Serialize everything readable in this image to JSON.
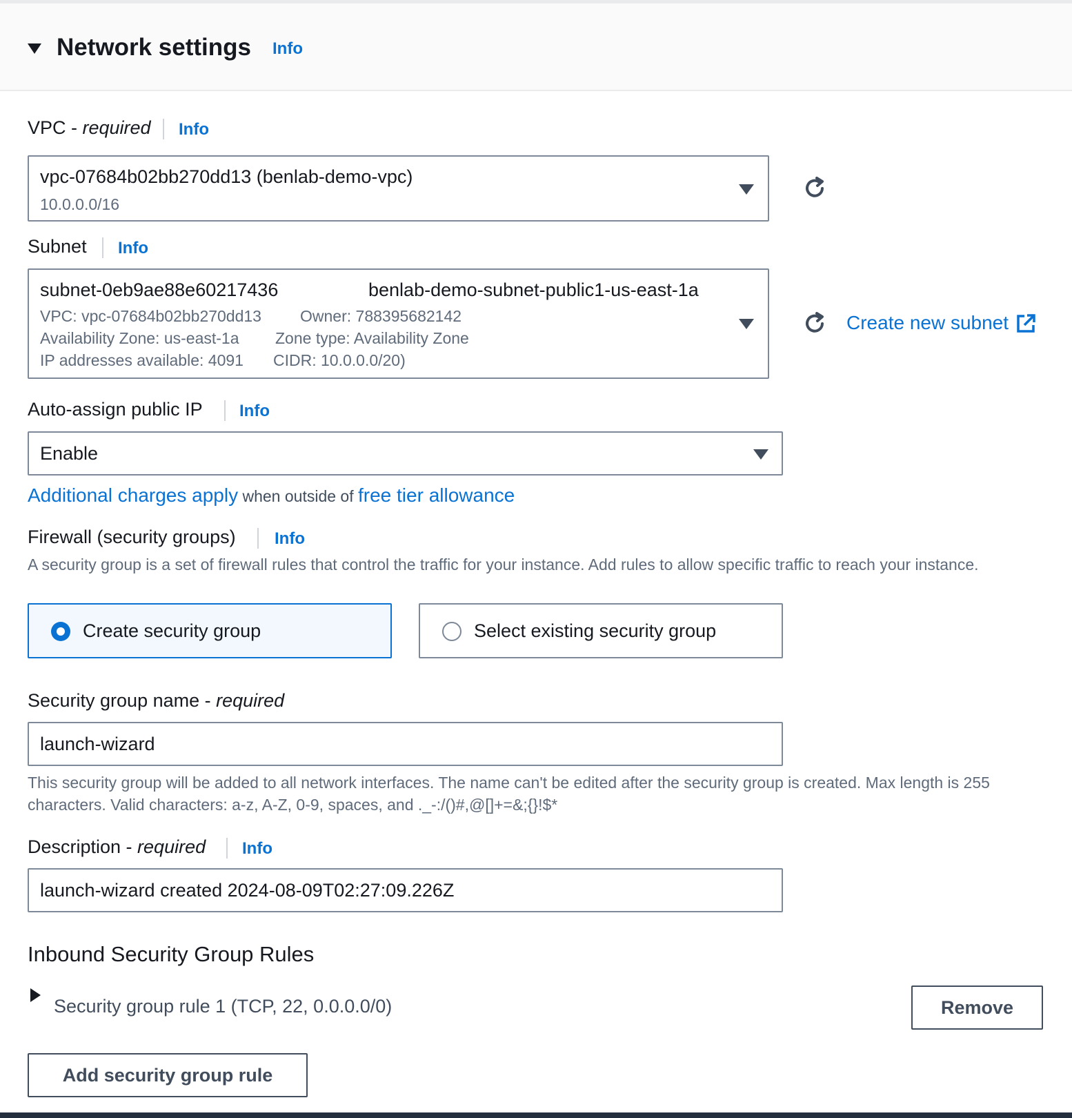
{
  "header": {
    "title": "Network settings",
    "info": "Info"
  },
  "vpc": {
    "label": "VPC - ",
    "label_req": "required",
    "info": "Info",
    "value": "vpc-07684b02bb270dd13 (benlab-demo-vpc)",
    "cidr": "10.0.0.0/16"
  },
  "subnet": {
    "label": "Subnet",
    "info": "Info",
    "id": "subnet-0eb9ae88e60217436",
    "name": "benlab-demo-subnet-public1-us-east-1a",
    "vpc": "VPC: vpc-07684b02bb270dd13",
    "owner": "Owner: 788395682142",
    "az": "Availability Zone: us-east-1a",
    "zone_type": "Zone type: Availability Zone",
    "ips": "IP addresses available: 4091",
    "cidr": "CIDR: 10.0.0.0/20)",
    "create_link": "Create new subnet"
  },
  "auto_ip": {
    "label": "Auto-assign public IP",
    "info": "Info",
    "value": "Enable",
    "charges_link": "Additional charges apply",
    "charges_mid": " when outside of ",
    "free_tier_link": "free tier allowance"
  },
  "firewall": {
    "label": "Firewall (security groups)",
    "info": "Info",
    "description": "A security group is a set of firewall rules that control the traffic for your instance. Add rules to allow specific traffic to reach your instance.",
    "option_create": "Create security group",
    "option_existing": "Select existing security group"
  },
  "sg_name": {
    "label": "Security group name - ",
    "label_req": "required",
    "value": "launch-wizard",
    "help": "This security group will be added to all network interfaces. The name can't be edited after the security group is created. Max length is 255 characters. Valid characters: a-z, A-Z, 0-9, spaces, and ._-:/()#,@[]+=&;{}!$*"
  },
  "description": {
    "label": "Description - ",
    "label_req": "required",
    "info": "Info",
    "value": "launch-wizard created 2024-08-09T02:27:09.226Z"
  },
  "inbound": {
    "title": "Inbound Security Group Rules",
    "rule1": "Security group rule 1 (TCP, 22, 0.0.0.0/0)",
    "remove": "Remove",
    "add": "Add security group rule"
  },
  "colors": {
    "accent": "#0972d3",
    "text": "#16191f",
    "muted": "#5f6b7a"
  }
}
